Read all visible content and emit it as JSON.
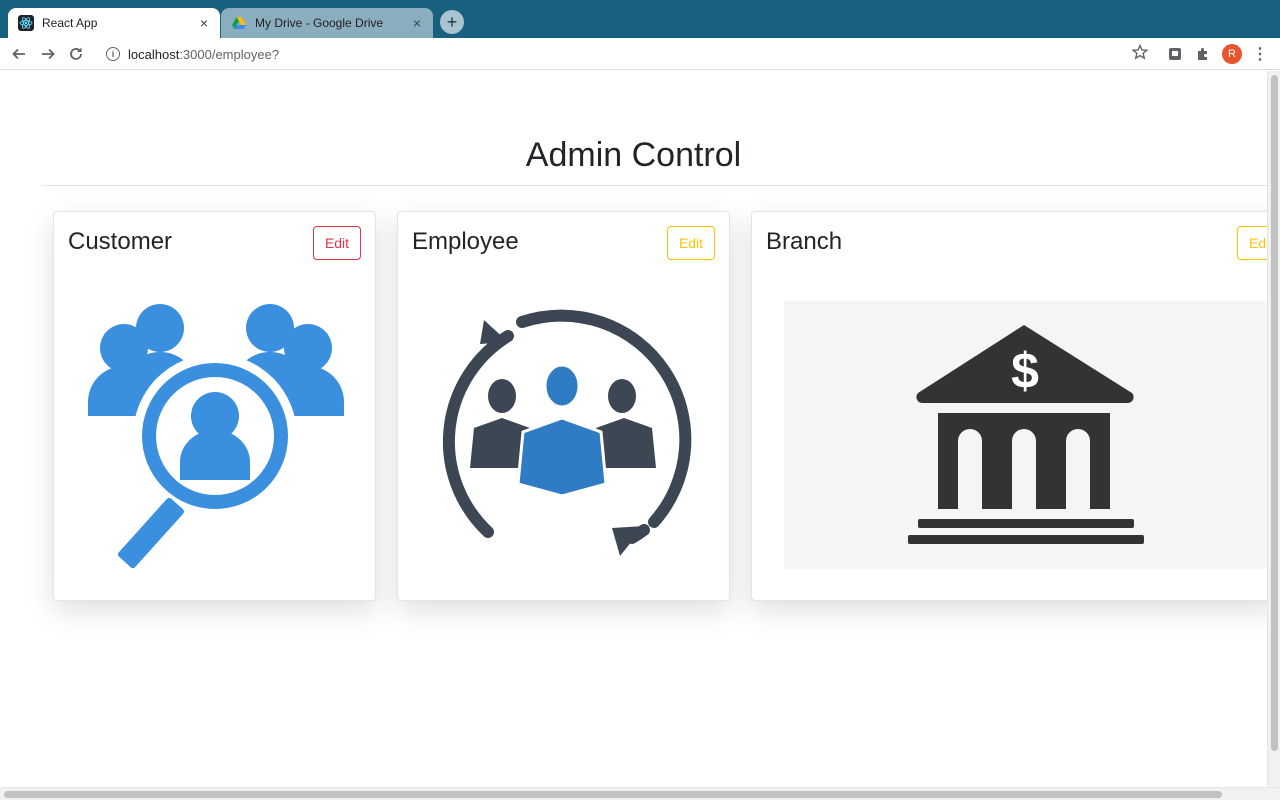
{
  "browser": {
    "tabs": [
      {
        "title": "React App",
        "active": true,
        "favicon": "react-icon"
      },
      {
        "title": "My Drive - Google Drive",
        "active": false,
        "favicon": "google-drive-icon"
      }
    ],
    "new_tab_symbol": "+",
    "close_symbol": "×",
    "url_host": "localhost",
    "url_path": ":3000/employee?",
    "avatar_initial": "R",
    "colors": {
      "tabstrip": "#17617f",
      "avatar": "#e8542d"
    }
  },
  "page": {
    "title": "Admin Control",
    "cards": [
      {
        "title": "Customer",
        "edit_label": "Edit",
        "button_style": "danger",
        "image": "customer-search-icon",
        "image_color": "#3a8fde"
      },
      {
        "title": "Employee",
        "edit_label": "Edit",
        "button_style": "warning",
        "image": "employee-cycle-icon",
        "image_color": "#3d4754"
      },
      {
        "title": "Branch",
        "edit_label": "Edit",
        "button_style": "warning",
        "image": "bank-icon",
        "image_color": "#333333"
      }
    ]
  },
  "colors": {
    "danger": "#dc3545",
    "warning": "#ffc107"
  }
}
